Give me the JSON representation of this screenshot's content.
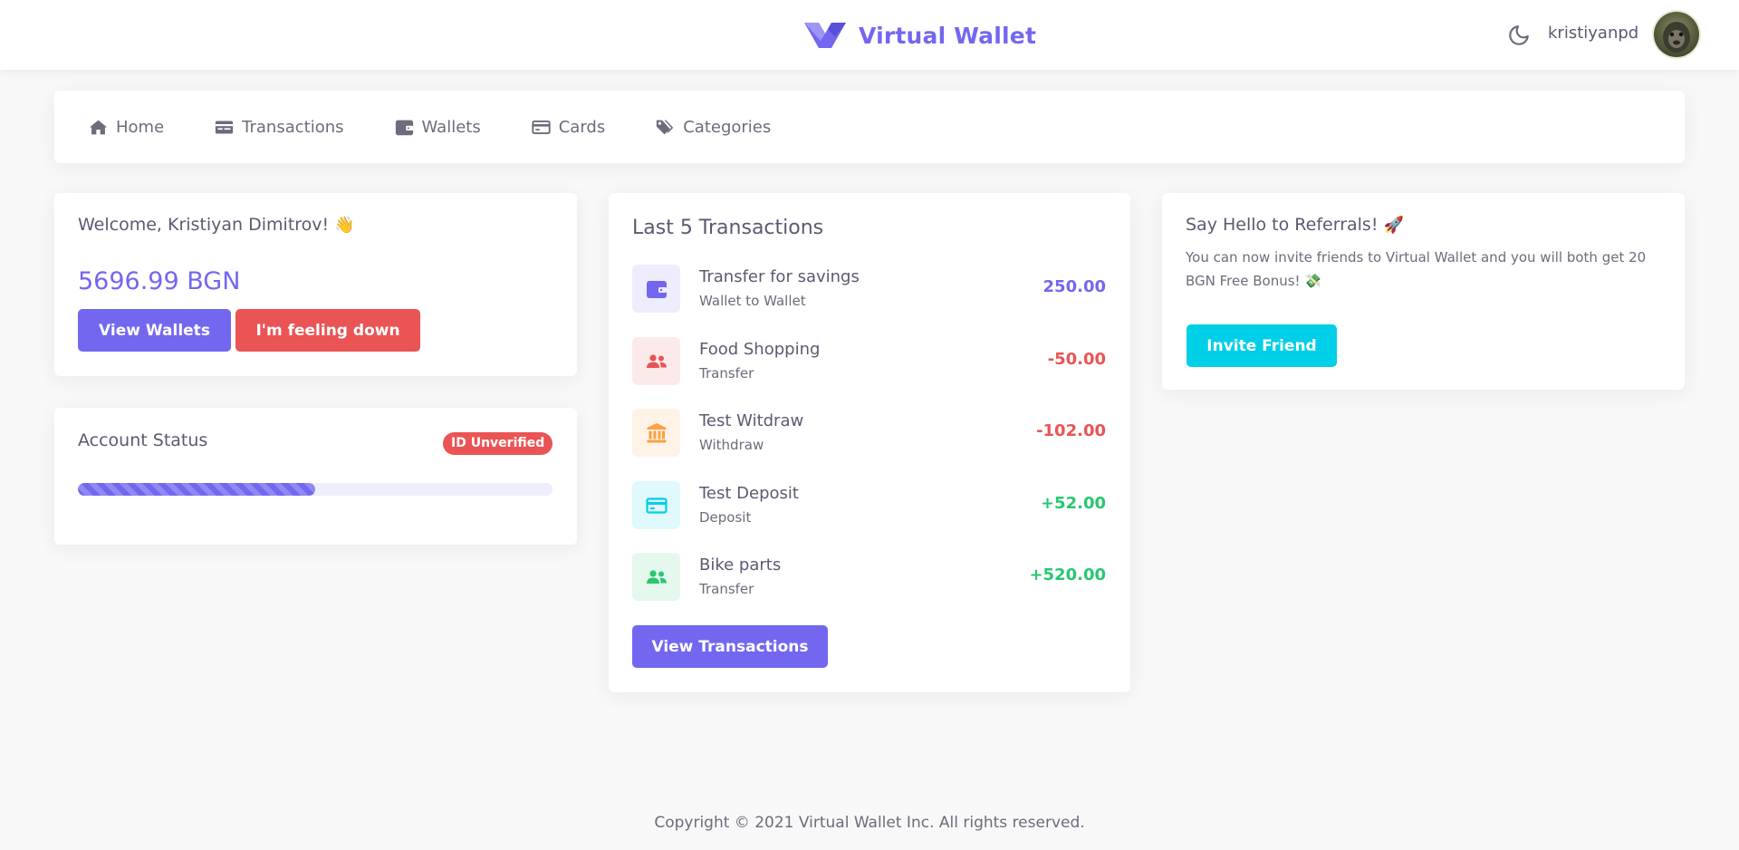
{
  "header": {
    "brand_name": "Virtual Wallet",
    "username": "kristiyanpd",
    "logo_icon": "virtual-wallet-logo-icon",
    "theme_icon": "moon-icon",
    "avatar": "user-avatar"
  },
  "nav": {
    "items": [
      {
        "label": "Home",
        "icon": "home-icon"
      },
      {
        "label": "Transactions",
        "icon": "transactions-icon"
      },
      {
        "label": "Wallets",
        "icon": "wallet-icon"
      },
      {
        "label": "Cards",
        "icon": "credit-card-icon"
      },
      {
        "label": "Categories",
        "icon": "tags-icon"
      }
    ]
  },
  "welcome": {
    "title": "Welcome, Kristiyan Dimitrov!",
    "emoji": "👋",
    "balance": "5696.99 BGN",
    "view_wallets_label": "View Wallets",
    "feeling_down_label": "I'm feeling down"
  },
  "account_status": {
    "title": "Account Status",
    "badge": "ID Unverified",
    "progress_percent": 50
  },
  "transactions": {
    "title": "Last 5 Transactions",
    "items": [
      {
        "name": "Transfer for savings",
        "type": "Wallet to Wallet",
        "amount": "250.00",
        "color": "#7367f0",
        "icon": "wallet-icon",
        "icon_bg": "#eeedfd",
        "icon_color": "#7367f0"
      },
      {
        "name": "Food Shopping",
        "type": "Transfer",
        "amount": "-50.00",
        "color": "#ea5455",
        "icon": "users-icon",
        "icon_bg": "#fceaea",
        "icon_color": "#ea5455"
      },
      {
        "name": "Test Witdraw",
        "type": "Withdraw",
        "amount": "-102.00",
        "color": "#ea5455",
        "icon": "bank-icon",
        "icon_bg": "#fff3e8",
        "icon_color": "#ff9f43"
      },
      {
        "name": "Test Deposit",
        "type": "Deposit",
        "amount": "+52.00",
        "color": "#28c76f",
        "icon": "credit-card-icon",
        "icon_bg": "#e0f9fc",
        "icon_color": "#00cfe8"
      },
      {
        "name": "Bike parts",
        "type": "Transfer",
        "amount": "+520.00",
        "color": "#28c76f",
        "icon": "users-icon",
        "icon_bg": "#e5f8ed",
        "icon_color": "#28c76f"
      }
    ],
    "view_transactions_label": "View Transactions"
  },
  "referrals": {
    "title": "Say Hello to Referrals!",
    "title_emoji": "🚀",
    "text": "You can now invite friends to Virtual Wallet and you will both get 20 BGN Free Bonus!",
    "text_emoji": "💸",
    "invite_label": "Invite Friend"
  },
  "footer": {
    "text": "Copyright © 2021 Virtual Wallet Inc. All rights reserved."
  },
  "colors": {
    "primary": "#7367f0",
    "danger": "#ea5455",
    "success": "#28c76f",
    "info": "#00cfe8",
    "warning": "#ff9f43"
  }
}
